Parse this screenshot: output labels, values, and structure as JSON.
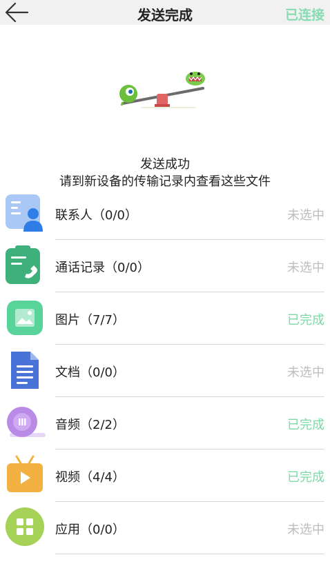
{
  "header": {
    "title": "发送完成",
    "status": "已连接"
  },
  "result": {
    "line1": "发送成功",
    "line2": "请到新设备的传输记录内查看这些文件"
  },
  "items": [
    {
      "label": "联系人（0/0）",
      "status": "未选中",
      "icon": "contacts-icon",
      "state": "unselected"
    },
    {
      "label": "通话记录（0/0）",
      "status": "未选中",
      "icon": "call-log-icon",
      "state": "unselected"
    },
    {
      "label": "图片（7/7）",
      "status": "已完成",
      "icon": "picture-icon",
      "state": "done"
    },
    {
      "label": "文档（0/0）",
      "status": "未选中",
      "icon": "document-icon",
      "state": "unselected"
    },
    {
      "label": "音频（2/2）",
      "status": "已完成",
      "icon": "audio-icon",
      "state": "done"
    },
    {
      "label": "视频（4/4）",
      "status": "已完成",
      "icon": "video-icon",
      "state": "done"
    },
    {
      "label": "应用（0/0）",
      "status": "未选中",
      "icon": "app-icon",
      "state": "unselected"
    }
  ],
  "colors": {
    "accent_green": "#7ed9a8",
    "inactive_gray": "#bdbdbd",
    "header_bg": "#f1f1f1"
  }
}
